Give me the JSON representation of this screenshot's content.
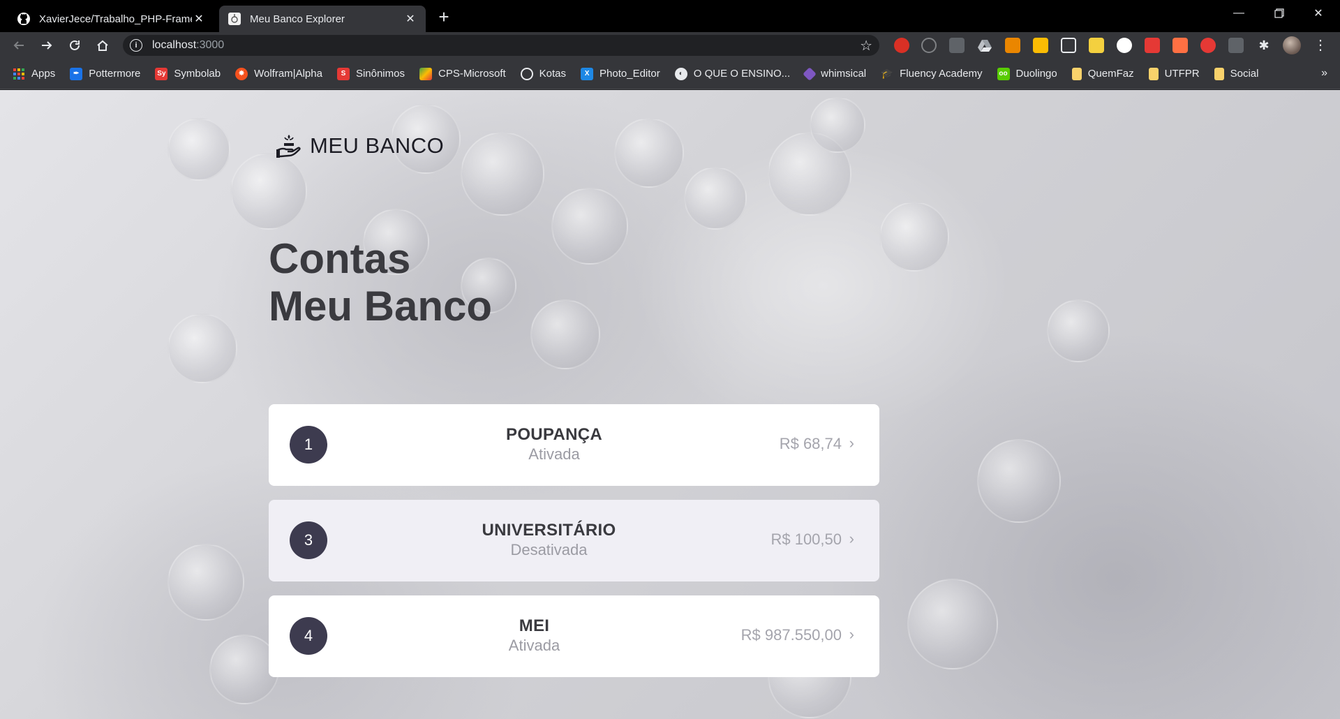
{
  "browser": {
    "tabs": [
      {
        "title": "XavierJece/Trabalho_PHP-Framew",
        "favicon": "github-icon"
      },
      {
        "title": "Meu Banco Explorer",
        "favicon": "meu-banco-icon"
      }
    ],
    "url": {
      "host": "localhost",
      "port": ":3000"
    },
    "bookmarks": [
      {
        "label": "Apps",
        "icon": "apps-grid-icon",
        "color": "#4285f4"
      },
      {
        "label": "Pottermore",
        "icon": "pottermore-icon",
        "color": "#1a73e8"
      },
      {
        "label": "Symbolab",
        "icon": "symbolab-icon",
        "color": "#e53935"
      },
      {
        "label": "Wolfram|Alpha",
        "icon": "wolfram-icon",
        "color": "#f4511e"
      },
      {
        "label": "Sinônimos",
        "icon": "sinonimos-icon",
        "color": "#e53935"
      },
      {
        "label": "CPS-Microsoft",
        "icon": "cps-icon",
        "color": "#43a047"
      },
      {
        "label": "Kotas",
        "icon": "kotas-icon",
        "color": "#5f6368"
      },
      {
        "label": "Photo_Editor",
        "icon": "photo-editor-icon",
        "color": "#1e88e5"
      },
      {
        "label": "O QUE O ENSINO...",
        "icon": "globe-icon",
        "color": "#5f6368"
      },
      {
        "label": "whimsical",
        "icon": "whimsical-icon",
        "color": "#7e57c2"
      },
      {
        "label": "Fluency Academy",
        "icon": "fluency-icon",
        "color": "#9e9e9e"
      },
      {
        "label": "Duolingo",
        "icon": "duolingo-icon",
        "color": "#58cc02"
      },
      {
        "label": "QuemFaz",
        "icon": "folder-icon",
        "color": "#f9d26b"
      },
      {
        "label": "UTFPR",
        "icon": "folder-icon",
        "color": "#f9d26b"
      },
      {
        "label": "Social",
        "icon": "folder-icon",
        "color": "#f9d26b"
      }
    ]
  },
  "app": {
    "logo_text": "MEU BANCO",
    "heading_line1": "Contas",
    "heading_line2": "Meu Banco",
    "accounts": [
      {
        "number": "1",
        "type": "POUPANÇA",
        "status": "Ativada",
        "balance": "R$ 68,74",
        "active": true
      },
      {
        "number": "3",
        "type": "UNIVERSITÁRIO",
        "status": "Desativada",
        "balance": "R$ 100,50",
        "active": false
      },
      {
        "number": "4",
        "type": "MEI",
        "status": "Ativada",
        "balance": "R$ 987.550,00",
        "active": true
      }
    ]
  },
  "colors": {
    "accent": "#3d3b4f",
    "heading": "#3a3a3f",
    "muted": "#9b9ba3"
  }
}
